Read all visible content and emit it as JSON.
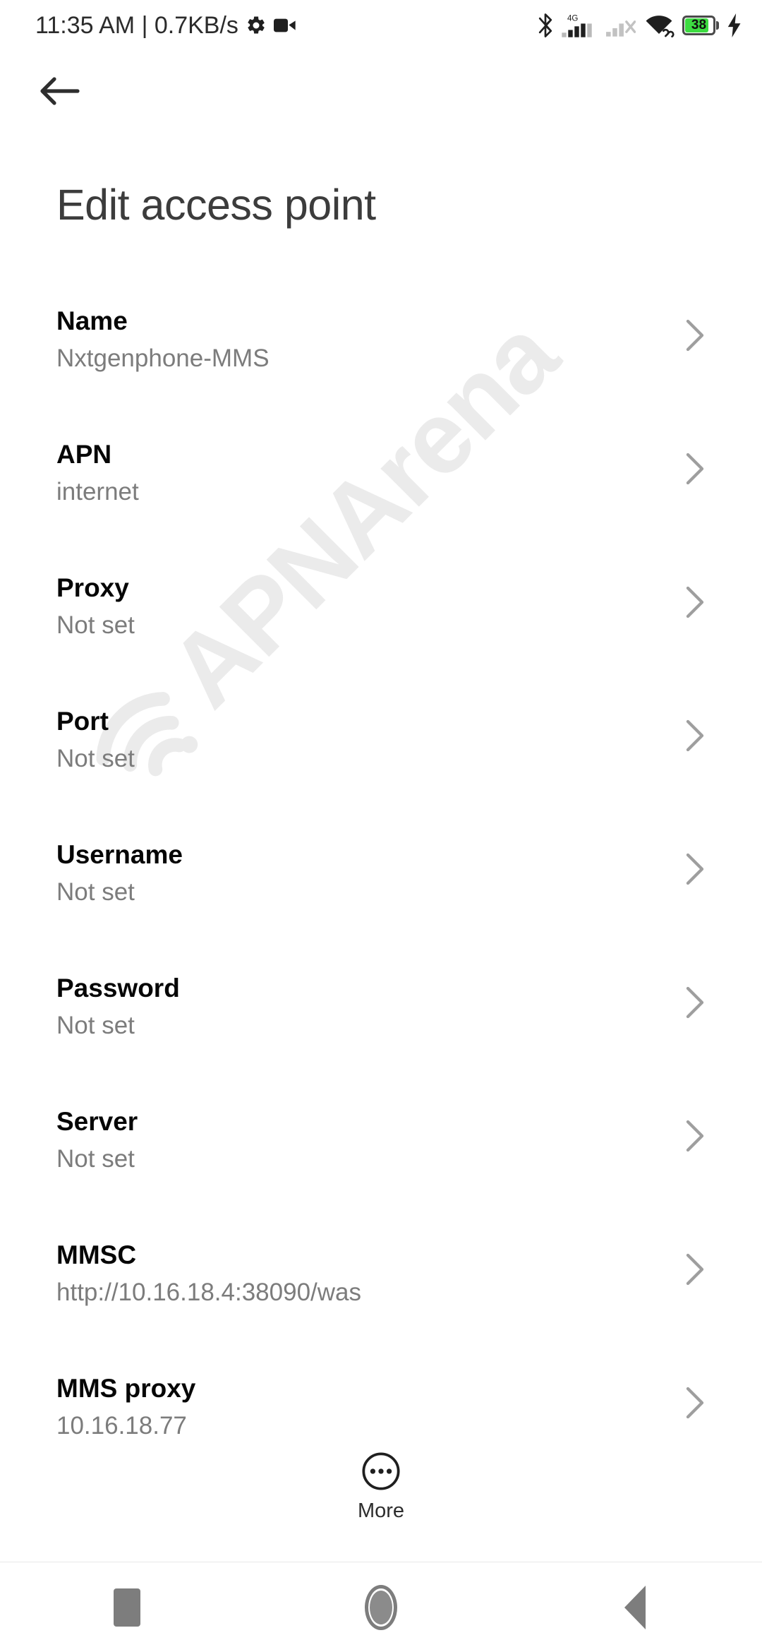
{
  "status_bar": {
    "time_and_speed": "11:35 AM | 0.7KB/s",
    "left_icons": [
      "gear-icon",
      "video-camera-icon"
    ],
    "right_icons": [
      "bluetooth-icon",
      "signal-4g-icon",
      "signal-no-service-icon",
      "wifi-icon",
      "battery-icon",
      "charging-bolt-icon"
    ],
    "network_type": "4G",
    "battery_percent": "38"
  },
  "header": {
    "back_label": "Back",
    "title": "Edit access point"
  },
  "list": {
    "rows": [
      {
        "label": "Name",
        "value": "Nxtgenphone-MMS"
      },
      {
        "label": "APN",
        "value": "internet"
      },
      {
        "label": "Proxy",
        "value": "Not set"
      },
      {
        "label": "Port",
        "value": "Not set"
      },
      {
        "label": "Username",
        "value": "Not set"
      },
      {
        "label": "Password",
        "value": "Not set"
      },
      {
        "label": "Server",
        "value": "Not set"
      },
      {
        "label": "MMSC",
        "value": "http://10.16.18.4:38090/was"
      },
      {
        "label": "MMS proxy",
        "value": "10.16.18.77"
      }
    ]
  },
  "more": {
    "label": "More",
    "icon": "circled-ellipsis-icon"
  },
  "nav_bar": {
    "recents_label": "Recents",
    "home_label": "Home",
    "back_label": "Back"
  },
  "watermark": {
    "text": "APNArena"
  },
  "colors": {
    "background": "#ffffff",
    "label_text": "#060606",
    "value_text": "#7c7c7c",
    "title_text": "#3c3c3c",
    "chevron": "#9e9e9e",
    "watermark": "#ebebeb",
    "battery_green": "#3ddc41",
    "nav_icon": "#7d7d7d"
  }
}
